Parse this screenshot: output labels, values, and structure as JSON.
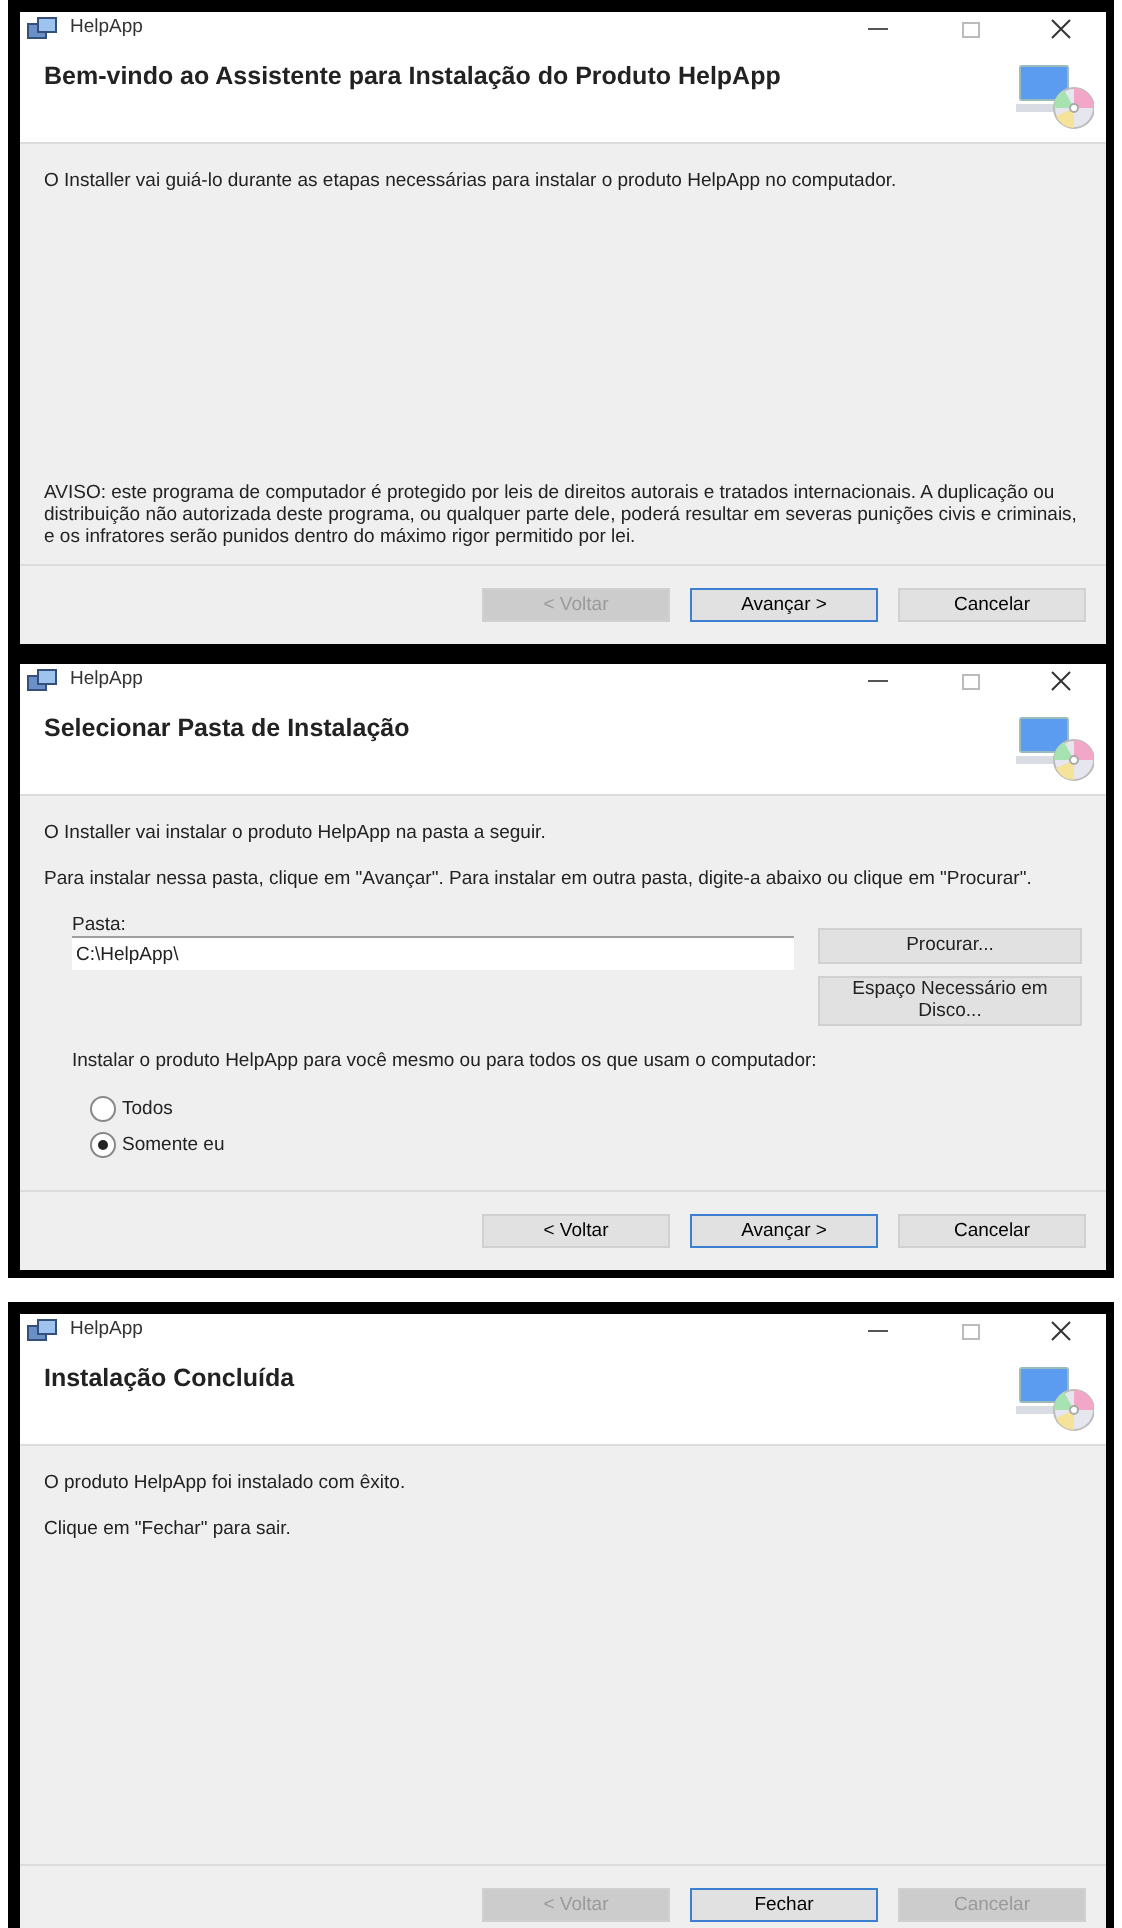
{
  "windows": [
    {
      "title": "HelpApp",
      "heading": "Bem-vindo ao Assistente para Instalação do Produto HelpApp",
      "body": [
        {
          "kind": "paragraph",
          "text": "O Installer vai guiá-lo durante as etapas necessárias para instalar o produto HelpApp no computador."
        },
        {
          "kind": "notice",
          "text": "AVISO: este programa de computador é protegido por leis de direitos autorais e tratados internacionais. A duplicação ou distribuição não autorizada deste programa, ou qualquer parte dele, poderá resultar em severas punições civis e criminais, e os infratores serão punidos dentro do máximo rigor permitido por lei."
        }
      ],
      "buttons": [
        {
          "label": "< Voltar",
          "disabled": true,
          "focused": false
        },
        {
          "label": "Avançar >",
          "disabled": false,
          "focused": true
        },
        {
          "label": "Cancelar",
          "disabled": false,
          "focused": false
        }
      ]
    },
    {
      "title": "HelpApp",
      "heading": "Selecionar Pasta de Instalação",
      "body": [
        {
          "kind": "paragraph",
          "text": "O Installer vai instalar o produto HelpApp na pasta a seguir."
        },
        {
          "kind": "paragraph",
          "text": "Para instalar nessa pasta, clique em \"Avançar\". Para instalar em outra pasta, digite-a abaixo ou clique em \"Procurar\"."
        },
        {
          "kind": "folder",
          "label": "Pasta:",
          "value": "C:\\HelpApp\\",
          "browse": "Procurar...",
          "disk_cost": "Espaço Necessário em Disco..."
        },
        {
          "kind": "radios",
          "prompt": "Instalar o produto HelpApp para você mesmo ou para todos os que usam o computador:",
          "options": [
            {
              "label": "Todos",
              "selected": false
            },
            {
              "label": "Somente eu",
              "selected": true
            }
          ]
        }
      ],
      "buttons": [
        {
          "label": "< Voltar",
          "disabled": false,
          "focused": false
        },
        {
          "label": "Avançar >",
          "disabled": false,
          "focused": true
        },
        {
          "label": "Cancelar",
          "disabled": false,
          "focused": false
        }
      ]
    },
    {
      "title": "HelpApp",
      "heading": "Instalação Concluída",
      "body": [
        {
          "kind": "paragraph",
          "text": "O produto HelpApp foi instalado com êxito."
        },
        {
          "kind": "paragraph",
          "text": "Clique em \"Fechar\" para sair."
        }
      ],
      "buttons": [
        {
          "label": "< Voltar",
          "disabled": true,
          "focused": false
        },
        {
          "label": "Fechar",
          "disabled": false,
          "focused": true
        },
        {
          "label": "Cancelar",
          "disabled": true,
          "focused": false
        }
      ]
    }
  ]
}
